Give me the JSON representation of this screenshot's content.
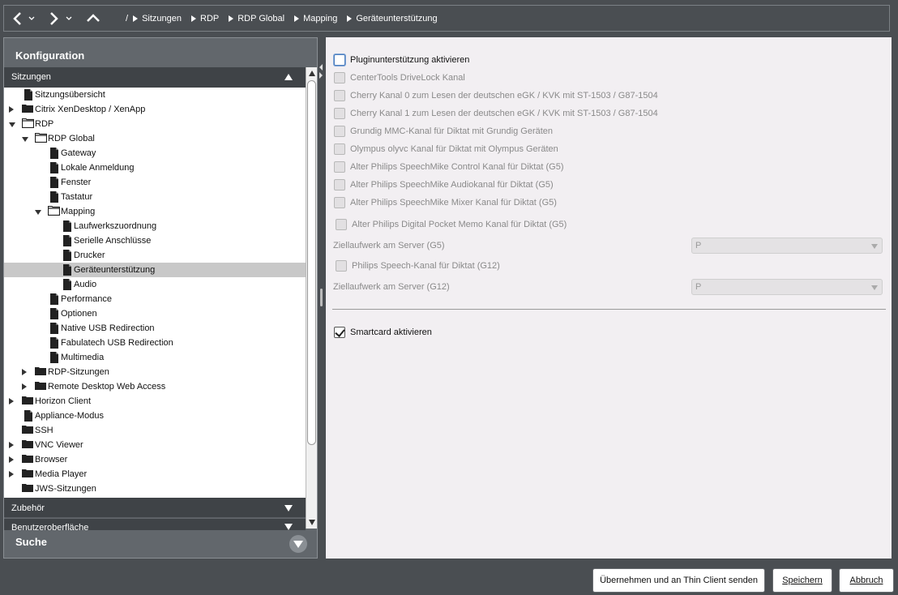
{
  "nav": {
    "crumb_sep": "/",
    "breadcrumbs": [
      "Sitzungen",
      "RDP",
      "RDP Global",
      "Mapping",
      "Geräteunterstützung"
    ]
  },
  "left": {
    "konfiguration": "Konfiguration",
    "sitzungen": "Sitzungen",
    "zubehoer": "Zubehör",
    "benutzeroberflaeche": "Benutzeroberfläche",
    "suche": "Suche"
  },
  "tree": [
    {
      "label": "Sitzungsübersicht",
      "icon": "file-icon",
      "level": 0,
      "exp": "none"
    },
    {
      "label": "Citrix XenDesktop / XenApp",
      "icon": "folder-filled-icon",
      "level": 0,
      "exp": "closed"
    },
    {
      "label": "RDP",
      "icon": "folder-open-icon",
      "level": 0,
      "exp": "open"
    },
    {
      "label": "RDP Global",
      "icon": "folder-open-icon",
      "level": 1,
      "exp": "open"
    },
    {
      "label": "Gateway",
      "icon": "file-icon",
      "level": 2,
      "exp": "none"
    },
    {
      "label": "Lokale Anmeldung",
      "icon": "file-icon",
      "level": 2,
      "exp": "none"
    },
    {
      "label": "Fenster",
      "icon": "file-icon",
      "level": 2,
      "exp": "none"
    },
    {
      "label": "Tastatur",
      "icon": "file-icon",
      "level": 2,
      "exp": "none"
    },
    {
      "label": "Mapping",
      "icon": "folder-open-icon",
      "level": 2,
      "exp": "open"
    },
    {
      "label": "Laufwerkszuordnung",
      "icon": "file-icon",
      "level": 3,
      "exp": "none"
    },
    {
      "label": "Serielle Anschlüsse",
      "icon": "file-icon",
      "level": 3,
      "exp": "none"
    },
    {
      "label": "Drucker",
      "icon": "file-icon",
      "level": 3,
      "exp": "none"
    },
    {
      "label": "Geräteunterstützung",
      "icon": "file-icon",
      "level": 3,
      "exp": "none",
      "selected": true
    },
    {
      "label": "Audio",
      "icon": "file-icon",
      "level": 3,
      "exp": "none"
    },
    {
      "label": "Performance",
      "icon": "file-icon",
      "level": 2,
      "exp": "none"
    },
    {
      "label": "Optionen",
      "icon": "file-icon",
      "level": 2,
      "exp": "none"
    },
    {
      "label": "Native USB Redirection",
      "icon": "file-icon",
      "level": 2,
      "exp": "none"
    },
    {
      "label": "Fabulatech USB Redirection",
      "icon": "file-icon",
      "level": 2,
      "exp": "none"
    },
    {
      "label": "Multimedia",
      "icon": "file-icon",
      "level": 2,
      "exp": "none"
    },
    {
      "label": "RDP-Sitzungen",
      "icon": "folder-filled-icon",
      "level": 1,
      "exp": "closed"
    },
    {
      "label": "Remote Desktop Web Access",
      "icon": "folder-filled-icon",
      "level": 1,
      "exp": "closed"
    },
    {
      "label": "Horizon Client",
      "icon": "folder-filled-icon",
      "level": 0,
      "exp": "closed"
    },
    {
      "label": "Appliance-Modus",
      "icon": "file-icon",
      "level": 0,
      "exp": "none"
    },
    {
      "label": "SSH",
      "icon": "folder-filled-icon",
      "level": 0,
      "exp": "none"
    },
    {
      "label": "VNC Viewer",
      "icon": "folder-filled-icon",
      "level": 0,
      "exp": "closed"
    },
    {
      "label": "Browser",
      "icon": "folder-filled-icon",
      "level": 0,
      "exp": "closed"
    },
    {
      "label": "Media Player",
      "icon": "folder-filled-icon",
      "level": 0,
      "exp": "closed"
    },
    {
      "label": "JWS-Sitzungen",
      "icon": "folder-filled-icon",
      "level": 0,
      "exp": "none"
    }
  ],
  "options": {
    "plugin": "Pluginunterstützung aktivieren",
    "centertools": "CenterTools DriveLock Kanal",
    "cherry0": "Cherry Kanal 0 zum Lesen der deutschen eGK / KVK mit ST-1503 / G87-1504",
    "cherry1": "Cherry Kanal 1 zum Lesen der deutschen eGK / KVK mit ST-1503 / G87-1504",
    "grundig": "Grundig MMC-Kanal für Diktat mit Grundig Geräten",
    "olympus": "Olympus olyvc Kanal für Diktat mit Olympus Geräten",
    "philips_control": "Alter Philips SpeechMike Control Kanal für Diktat (G5)",
    "philips_audio": "Alter Philips SpeechMike Audiokanal für Diktat (G5)",
    "philips_mixer": "Alter Philips SpeechMike Mixer Kanal für Diktat (G5)",
    "philips_dpm": "Alter Philips Digital Pocket Memo Kanal für Diktat (G5)",
    "ziel_g5_label": "Ziellaufwerk am Server (G5)",
    "ziel_g5_value": "P",
    "philips_speech": "Philips Speech-Kanal für Diktat (G12)",
    "ziel_g12_label": "Ziellaufwerk am Server (G12)",
    "ziel_g12_value": "P",
    "smartcard": "Smartcard aktivieren"
  },
  "buttons": {
    "apply": "Übernehmen und an Thin Client senden",
    "save": "Speichern",
    "cancel": "Abbruch"
  }
}
